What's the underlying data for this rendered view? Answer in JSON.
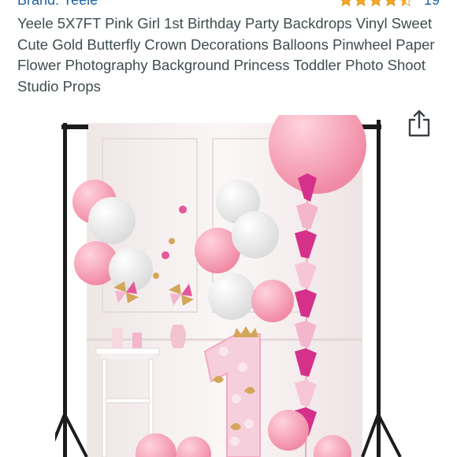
{
  "product": {
    "brand_line": "Brand: Yeele",
    "rating": {
      "stars": 4.5,
      "max_stars": 5,
      "count": "19"
    },
    "title": "Yeele 5X7FT Pink Girl 1st Birthday Party Backdrops Vinyl Sweet Cute Gold Butterfly Crown Decorations Balloons Pinwheel Paper Flower Photography Background Princess Toddler Photo Shoot Studio Props"
  },
  "icons": {
    "share": "share-icon",
    "star": "star-icon"
  },
  "colors": {
    "link": "#2162a1",
    "text": "#3f4c4f",
    "star": "#f5a623",
    "backdrop_pink": "#f4a7b9",
    "tassel_magenta": "#d6318a"
  }
}
